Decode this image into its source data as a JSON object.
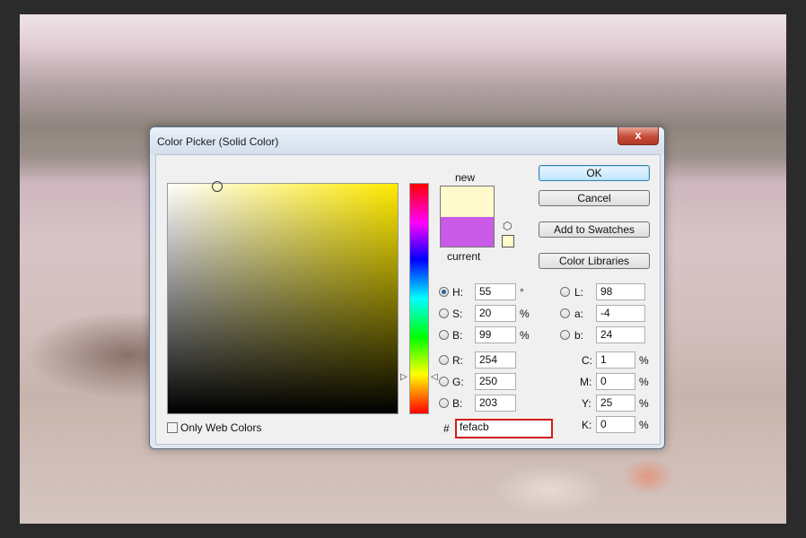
{
  "dialog": {
    "title": "Color Picker (Solid Color)",
    "close_glyph": "x",
    "only_web_colors_label": "Only Web Colors"
  },
  "swatch": {
    "new_label": "new",
    "current_label": "current",
    "new_color": "#fefacb",
    "current_color": "#c95be6",
    "cube_icon": "gamut-cube-icon"
  },
  "buttons": {
    "ok": "OK",
    "cancel": "Cancel",
    "add_to_swatches": "Add to Swatches",
    "color_libraries": "Color Libraries"
  },
  "hsb": {
    "h": {
      "label": "H:",
      "value": "55",
      "unit": "°"
    },
    "s": {
      "label": "S:",
      "value": "20",
      "unit": "%"
    },
    "b": {
      "label": "B:",
      "value": "99",
      "unit": "%"
    }
  },
  "rgb": {
    "r": {
      "label": "R:",
      "value": "254"
    },
    "g": {
      "label": "G:",
      "value": "250"
    },
    "b": {
      "label": "B:",
      "value": "203"
    }
  },
  "lab": {
    "l": {
      "label": "L:",
      "value": "98"
    },
    "a": {
      "label": "a:",
      "value": "-4"
    },
    "b": {
      "label": "b:",
      "value": "24"
    }
  },
  "cmyk": {
    "c": {
      "label": "C:",
      "value": "1",
      "unit": "%"
    },
    "m": {
      "label": "M:",
      "value": "0",
      "unit": "%"
    },
    "y": {
      "label": "Y:",
      "value": "25",
      "unit": "%"
    },
    "k": {
      "label": "K:",
      "value": "0",
      "unit": "%"
    }
  },
  "hex": {
    "label": "#",
    "value": "fefacb"
  },
  "selected_mode": "H"
}
